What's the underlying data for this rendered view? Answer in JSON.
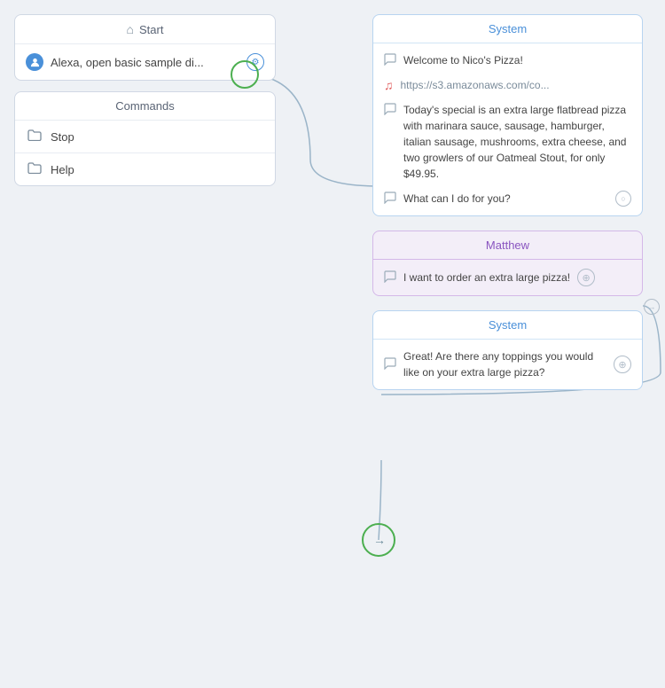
{
  "start": {
    "header_icon": "🏠",
    "title": "Start",
    "intent_text": "Alexa, open basic sample di...",
    "settings_icon": "⚙"
  },
  "commands": {
    "header": "Commands",
    "items": [
      {
        "label": "Stop",
        "icon": "folder"
      },
      {
        "label": "Help",
        "icon": "folder"
      }
    ]
  },
  "system1": {
    "header": "System",
    "messages": [
      {
        "type": "text",
        "content": "Welcome to Nico's Pizza!"
      },
      {
        "type": "link",
        "content": "https://s3.amazonaws.com/co..."
      },
      {
        "type": "text",
        "content": "Today's special is an extra large flatbread pizza with marinara sauce, sausage, hamburger, italian sausage, mushrooms, extra cheese, and two growlers of our Oatmeal Stout, for only $49.95."
      },
      {
        "type": "text",
        "content": "What can I do for you?"
      }
    ]
  },
  "matthew": {
    "header": "Matthew",
    "messages": [
      {
        "type": "text",
        "content": "I want to order an extra large pizza!"
      }
    ]
  },
  "system2": {
    "header": "System",
    "messages": [
      {
        "type": "text",
        "content": "Great! Are there any toppings you would like on your extra large pizza?"
      }
    ]
  },
  "icons": {
    "home": "⌂",
    "person": "👤",
    "gear": "⚙",
    "folder": "📁",
    "chat": "💬",
    "music": "♫",
    "arrow_right": "→"
  }
}
